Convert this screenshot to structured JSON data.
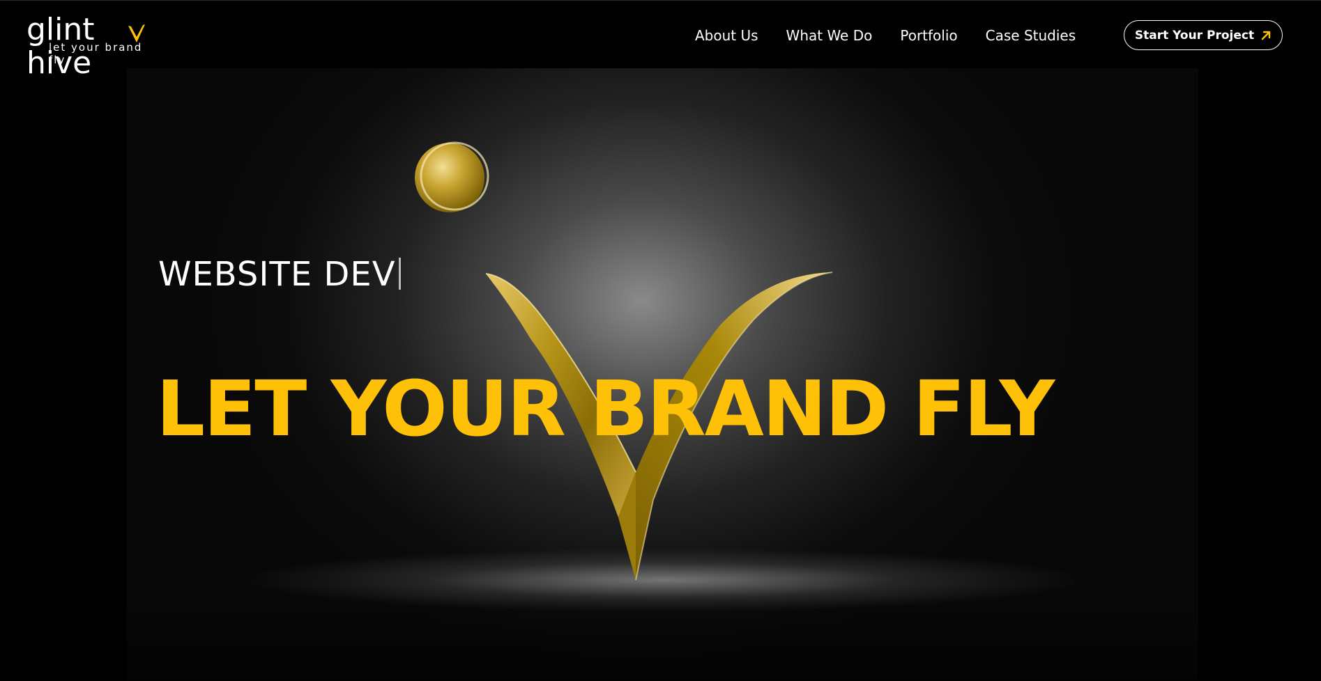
{
  "brand": {
    "name": "glint hive",
    "tagline": "let your brand fly",
    "logo_icon": "v-wing-icon",
    "accent_color": "#FFC107"
  },
  "nav": {
    "items": [
      {
        "label": "About Us"
      },
      {
        "label": "What We Do"
      },
      {
        "label": "Portfolio"
      },
      {
        "label": "Case Studies"
      }
    ],
    "cta_label": "Start Your Project",
    "cta_icon": "arrow-up-right-icon"
  },
  "hero": {
    "typed_text": "WEBSITE DEV",
    "headline": "LET YOUR BRAND FLY",
    "emblem": "gold-v-emblem"
  }
}
